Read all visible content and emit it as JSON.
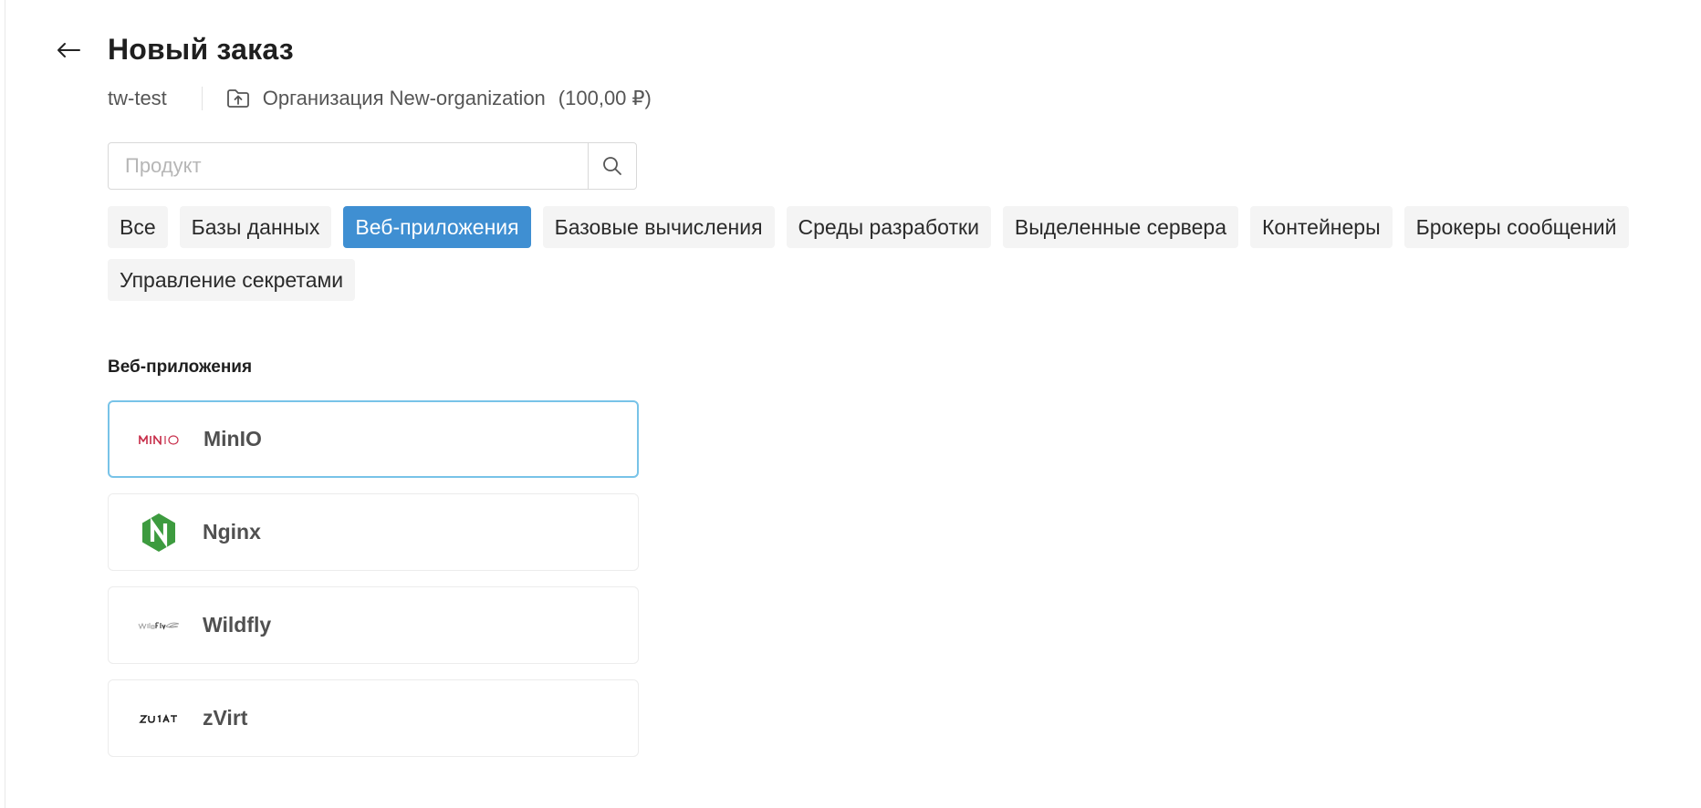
{
  "header": {
    "title": "Новый заказ"
  },
  "meta": {
    "project": "tw-test",
    "organization": "Организация New-organization",
    "balance": "(100,00 ₽)"
  },
  "search": {
    "placeholder": "Продукт",
    "value": ""
  },
  "tabs": [
    {
      "label": "Все",
      "active": false
    },
    {
      "label": "Базы данных",
      "active": false
    },
    {
      "label": "Веб-приложения",
      "active": true
    },
    {
      "label": "Базовые вычисления",
      "active": false
    },
    {
      "label": "Среды разработки",
      "active": false
    },
    {
      "label": "Выделенные сервера",
      "active": false
    },
    {
      "label": "Контейнеры",
      "active": false
    },
    {
      "label": "Брокеры сообщений",
      "active": false
    },
    {
      "label": "Управление секретами",
      "active": false
    }
  ],
  "section": {
    "title": "Веб-приложения"
  },
  "products": [
    {
      "name": "MinIO",
      "logo_text": "MINIO",
      "icon": "minio-logo-icon",
      "selected": true
    },
    {
      "name": "Nginx",
      "logo_text": "N",
      "icon": "nginx-logo-icon",
      "selected": false
    },
    {
      "name": "Wildfly",
      "logo_text": "WildFly",
      "icon": "wildfly-logo-icon",
      "selected": false
    },
    {
      "name": "zVirt",
      "logo_text": "ZVIRT",
      "icon": "zvirt-logo-icon",
      "selected": false
    }
  ],
  "colors": {
    "accent": "#3f8fd2",
    "selected_border": "#78c3e8",
    "minio_red": "#c72c48",
    "nginx_green": "#3d9b3f"
  }
}
